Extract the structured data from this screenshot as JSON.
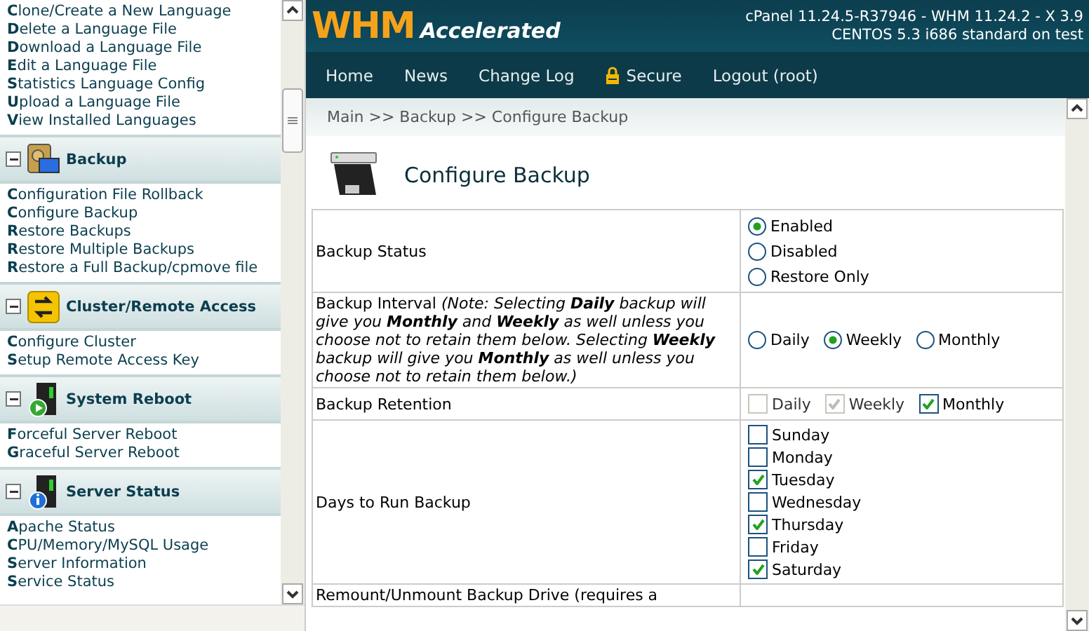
{
  "sidebar": {
    "sections": [
      {
        "kind": "links",
        "links": [
          "**C**lone/Create a New Language",
          "**D**elete a Language File",
          "**D**ownload a Language File",
          "**E**dit a Language File",
          "**S**tatistics Language Config",
          "**U**pload a Language File",
          "**V**iew Installed Languages"
        ]
      },
      {
        "kind": "group",
        "title": "Backup",
        "expanded": true,
        "links": [
          "**C**onfiguration File Rollback",
          "**C**onfigure Backup",
          "**R**estore Backups",
          "**R**estore Multiple Backups",
          "**R**estore a Full Backup/cpmove file"
        ]
      },
      {
        "kind": "group",
        "title": "Cluster/Remote Access",
        "expanded": true,
        "links": [
          "**C**onfigure Cluster",
          "**S**etup Remote Access Key"
        ]
      },
      {
        "kind": "group",
        "title": "System Reboot",
        "expanded": true,
        "links": [
          "**F**orceful Server Reboot",
          "**G**raceful Server Reboot"
        ]
      },
      {
        "kind": "group",
        "title": "Server Status",
        "expanded": true,
        "links": [
          "**A**pache Status",
          "**C**PU/Memory/MySQL Usage",
          "**S**erver Information",
          "**S**ervice Status"
        ]
      }
    ]
  },
  "header": {
    "logo_main": "WHM",
    "logo_sub": "Accelerated",
    "version_lines": [
      "cPanel 11.24.5-R37946 - WHM 11.24.2 - X 3.9",
      "CENTOS 5.3 i686 standard on test"
    ]
  },
  "nav": [
    {
      "label": "Home",
      "kind": "plain"
    },
    {
      "label": "News",
      "kind": "plain"
    },
    {
      "label": "Change Log",
      "kind": "plain"
    },
    {
      "label": "Secure",
      "kind": "lock"
    },
    {
      "label": "Logout (root)",
      "kind": "plain"
    }
  ],
  "breadcrumb": "Main >> Backup >> Configure Backup",
  "page_title": "Configure Backup",
  "rows": [
    {
      "label": "Backup Status",
      "kind": "radio_stack",
      "options": [
        {
          "label": "Enabled",
          "selected": true
        },
        {
          "label": "Disabled",
          "selected": false
        },
        {
          "label": "Restore Only",
          "selected": false
        }
      ]
    },
    {
      "label": "Backup Interval",
      "note": "(Note: Selecting **Daily** backup will give you **Monthly** and **Weekly** as well unless you choose not to retain them below. Selecting **Weekly** backup will give you **Monthly** as well unless you choose not to retain them below.)",
      "kind": "radio_row",
      "options": [
        {
          "label": "Daily",
          "selected": false
        },
        {
          "label": "Weekly",
          "selected": true
        },
        {
          "label": "Monthly",
          "selected": false
        }
      ]
    },
    {
      "label": "Backup Retention",
      "kind": "check_row",
      "options": [
        {
          "label": "Daily",
          "checked": false,
          "disabled": true
        },
        {
          "label": "Weekly",
          "checked": true,
          "disabled": true
        },
        {
          "label": "Monthly",
          "checked": true,
          "disabled": false
        }
      ]
    },
    {
      "label": "Days to Run Backup",
      "kind": "check_stack",
      "options": [
        {
          "label": "Sunday",
          "checked": false,
          "disabled": false
        },
        {
          "label": "Monday",
          "checked": false,
          "disabled": false
        },
        {
          "label": "Tuesday",
          "checked": true,
          "disabled": false
        },
        {
          "label": "Wednesday",
          "checked": false,
          "disabled": false
        },
        {
          "label": "Thursday",
          "checked": true,
          "disabled": false
        },
        {
          "label": "Friday",
          "checked": false,
          "disabled": false
        },
        {
          "label": "Saturday",
          "checked": true,
          "disabled": false
        }
      ]
    },
    {
      "label": "Remount/Unmount Backup Drive (requires a",
      "kind": "empty"
    }
  ]
}
